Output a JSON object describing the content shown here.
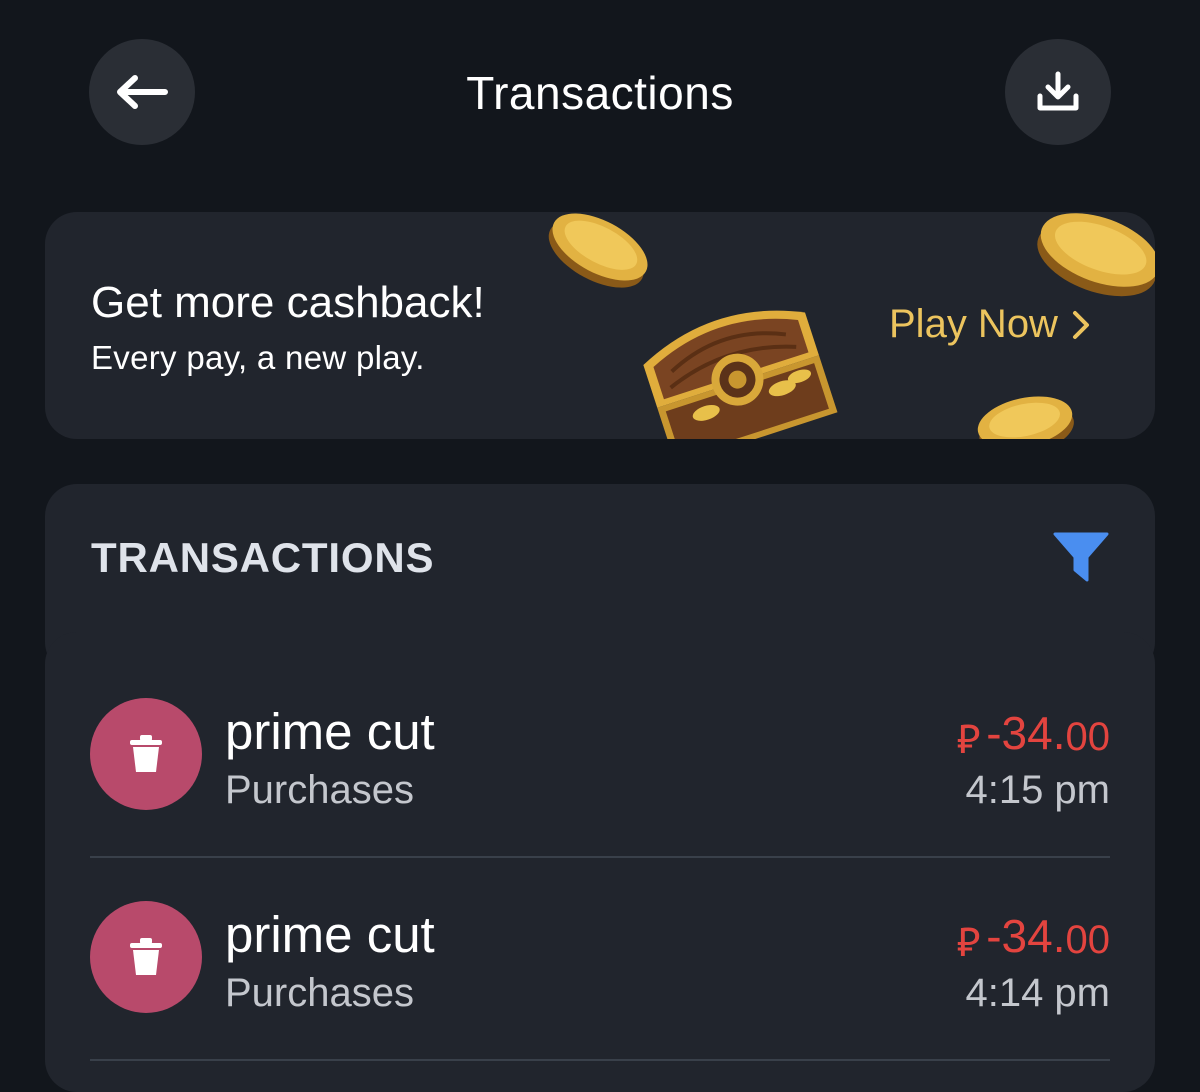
{
  "header": {
    "title": "Transactions",
    "back_icon": "arrow-left-icon",
    "download_icon": "download-icon"
  },
  "banner": {
    "title": "Get more cashback!",
    "subtitle": "Every pay, a new play.",
    "cta_label": "Play Now",
    "cta_icon": "chevron-right-icon",
    "art": "treasure-chest-with-coins"
  },
  "transactions_section": {
    "label": "TRANSACTIONS",
    "filter_icon": "filter-icon",
    "items": [
      {
        "name": "prime cut",
        "category": "Purchases",
        "currency_symbol": "⃁",
        "amount_whole": "-34.",
        "amount_decimal": "00",
        "time": "4:15 pm",
        "icon": "trash-icon"
      },
      {
        "name": "prime cut",
        "category": "Purchases",
        "currency_symbol": "⃁",
        "amount_whole": "-34.",
        "amount_decimal": "00",
        "time": "4:14 pm",
        "icon": "trash-icon"
      }
    ]
  },
  "colors": {
    "background": "#12161c",
    "card": "#21252d",
    "accent_gold": "#ecc45e",
    "negative_amount": "#e3443f",
    "filter_blue": "#4a8ef0",
    "category_icon_bg": "#b84a6b"
  }
}
